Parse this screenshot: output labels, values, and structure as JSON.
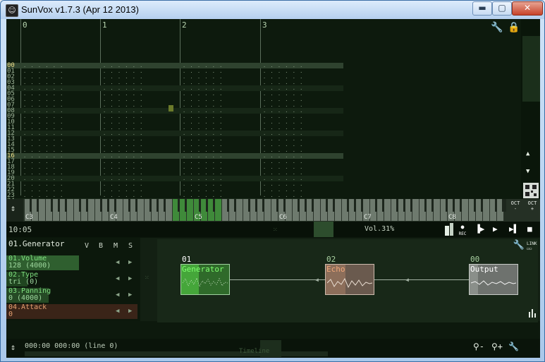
{
  "window": {
    "title": "SunVox v1.7.3 (Apr 12 2013)",
    "controls": {
      "minimize": "▬",
      "maximize": "▢",
      "close": "✕"
    }
  },
  "pattern": {
    "beats": [
      "0",
      "1",
      "2",
      "3"
    ],
    "rows": [
      "00",
      "01",
      "02",
      "03",
      "04",
      "05",
      "06",
      "07",
      "08",
      "09",
      "10",
      "11",
      "12",
      "13",
      "14",
      "15",
      "16",
      "17",
      "18",
      "19",
      "20",
      "21",
      "22",
      "23",
      "24"
    ],
    "highlight_rows": [
      "00",
      "16"
    ],
    "empty_cell": ". .   . . . ."
  },
  "icons": {
    "wrench": "wrench-icon",
    "lock": "lock-icon",
    "scroll_up": "▲",
    "scroll_down": "▼",
    "updown": "⇕"
  },
  "keyboard": {
    "octaves": [
      "C3",
      "C4",
      "C5",
      "C6",
      "C7",
      "C8"
    ],
    "oct_minus": "OCT\n-",
    "oct_plus": "OCT\n+"
  },
  "transport": {
    "time": "10:05",
    "volume": "Vol.31%",
    "rec_label": "REC"
  },
  "controller_panel": {
    "module_title": "01.Generator",
    "flags": [
      "V",
      "B",
      "M",
      "S"
    ],
    "controllers": [
      {
        "name": "01.Volume",
        "value": "128 (4000)"
      },
      {
        "name": "02.Type",
        "value": "tri (0)"
      },
      {
        "name": "03.Panning",
        "value": "0 (4000)"
      },
      {
        "name": "04.Attack",
        "value": "0"
      }
    ]
  },
  "modules": [
    {
      "num": "01",
      "name": "Generator"
    },
    {
      "num": "02",
      "name": "Echo"
    },
    {
      "num": "00",
      "name": "Output"
    }
  ],
  "link_label": "LINK",
  "timeline": {
    "position": "000:00 000:00 (line 0)",
    "label": "Timeline"
  },
  "colors": {
    "generator": "#3a8a2e",
    "echo": "#8c6e5a",
    "output": "#8a8f8a",
    "row_highlight": "#f0e08a"
  }
}
